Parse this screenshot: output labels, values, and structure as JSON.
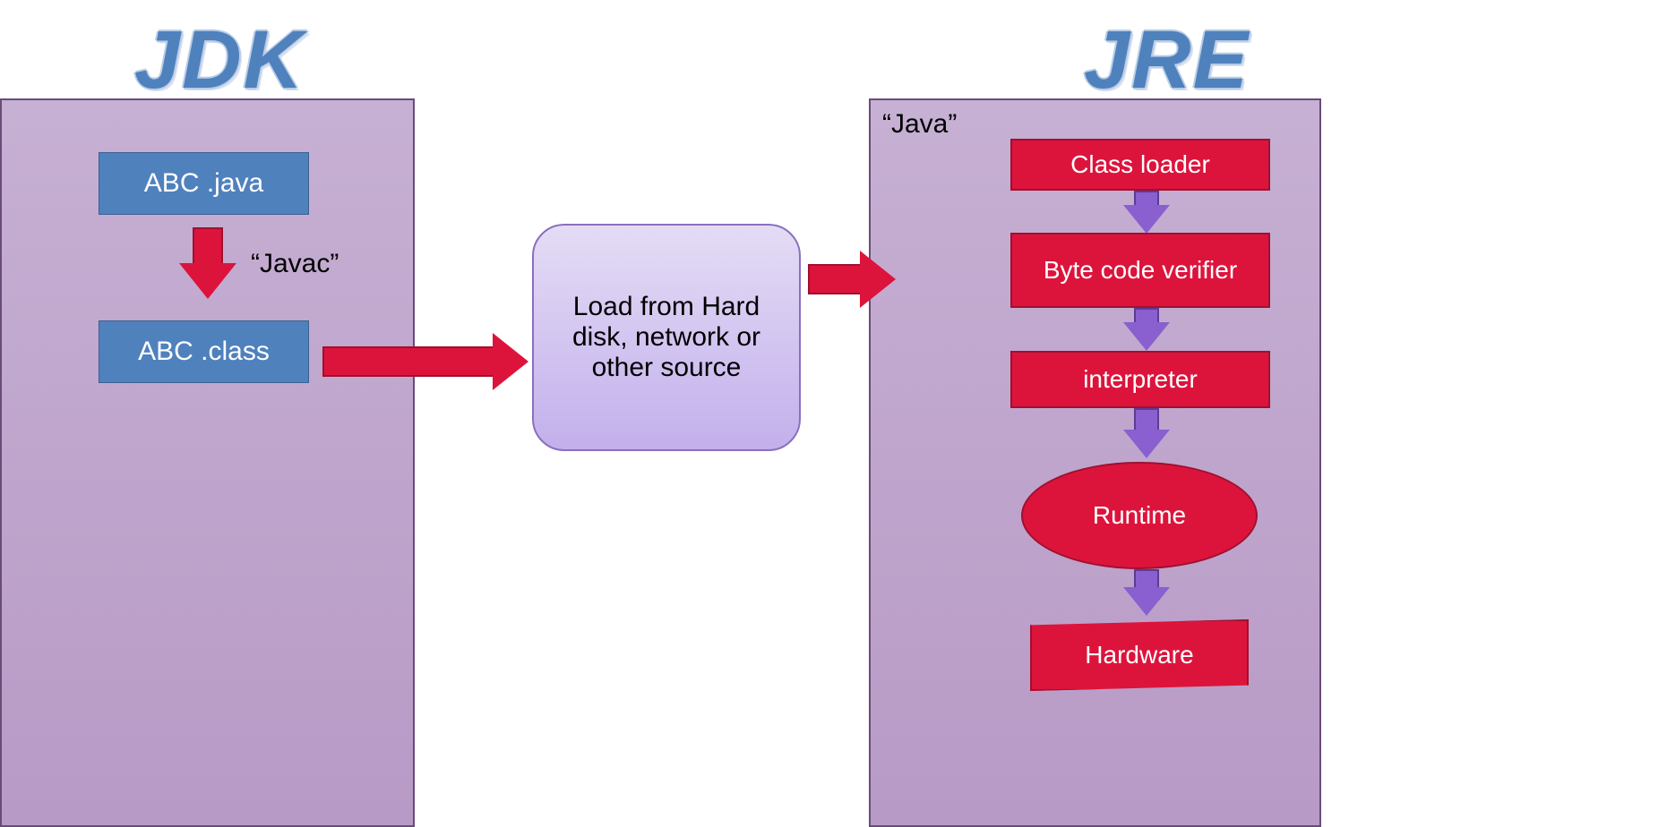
{
  "titles": {
    "jdk": "JDK",
    "jre": "JRE"
  },
  "jdk": {
    "java_file": "ABC .java",
    "class_file": "ABC .class",
    "compiler_label": "“Javac”"
  },
  "middle": {
    "load_text": "Load from Hard disk, network or other source"
  },
  "jre": {
    "java_label": "“Java”",
    "steps": {
      "class_loader": "Class loader",
      "byte_code_verifier": "Byte code verifier",
      "interpreter": "interpreter",
      "runtime": "Runtime",
      "hardware": "Hardware"
    }
  }
}
